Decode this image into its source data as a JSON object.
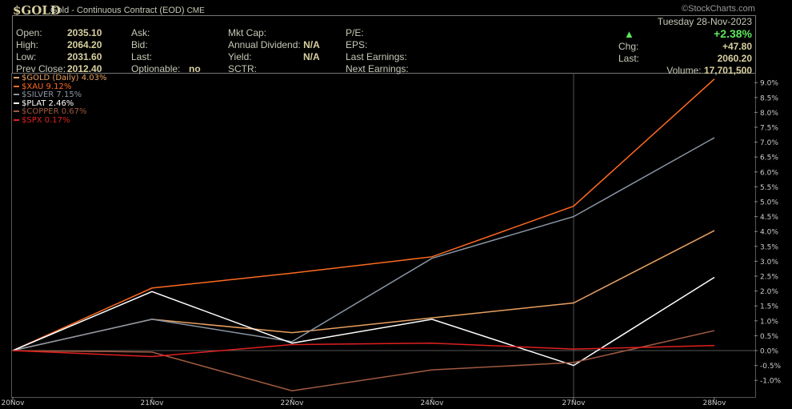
{
  "header": {
    "symbol": "$GOLD",
    "description": "Gold - Continuous Contract (EOD)",
    "exchange": "CME",
    "watermark": "©StockCharts.com"
  },
  "quote": {
    "open_label": "Open:",
    "open": "2035.10",
    "high_label": "High:",
    "high": "2064.20",
    "low_label": "Low:",
    "low": "2031.60",
    "prev_label": "Prev Close:",
    "prev": "2012.40",
    "ask_label": "Ask:",
    "bid_label": "Bid:",
    "last_label": "Last:",
    "optionable_label": "Optionable:",
    "optionable": "no",
    "mktcap_label": "Mkt Cap:",
    "div_label": "Annual Dividend:",
    "div": "N/A",
    "yield_label": "Yield:",
    "yield": "N/A",
    "sctr_label": "SCTR:",
    "pe_label": "P/E:",
    "eps_label": "EPS:",
    "lastearn_label": "Last Earnings:",
    "nextearn_label": "Next Earnings:",
    "date": "Tuesday  28-Nov-2023",
    "pct": "+2.38%",
    "chg_label": "Chg:",
    "chg": "+47.80",
    "last2_label": "Last:",
    "last2": "2060.20",
    "vol_label": "Volume:",
    "vol": "17,701,500"
  },
  "chart_data": {
    "type": "line",
    "categories": [
      "20Nov",
      "21Nov",
      "22Nov",
      "24Nov",
      "27Nov",
      "28Nov"
    ],
    "ylim": [
      -1.35,
      9.2
    ],
    "yticks": [
      "9.0%",
      "8.5%",
      "8.0%",
      "7.5%",
      "7.0%",
      "6.5%",
      "6.0%",
      "5.5%",
      "5.0%",
      "4.5%",
      "4.0%",
      "3.5%",
      "3.0%",
      "2.5%",
      "2.0%",
      "1.5%",
      "1.0%",
      "0.5%",
      "0.0%",
      "-0.5%",
      "-1.0%"
    ],
    "series": [
      {
        "name": "$GOLD (Daily) 4.03%",
        "color": "#e8a060",
        "values": [
          0,
          1.05,
          0.6,
          1.1,
          1.6,
          4.03
        ]
      },
      {
        "name": "$XAU 9.12%",
        "color": "#ff6a20",
        "values": [
          0,
          2.1,
          2.6,
          3.15,
          4.85,
          9.12
        ]
      },
      {
        "name": "$SILVER 7.15%",
        "color": "#8a96a4",
        "values": [
          0,
          1.05,
          0.3,
          3.1,
          4.5,
          7.15
        ]
      },
      {
        "name": "$PLAT 2.46%",
        "color": "#ffffff",
        "values": [
          0,
          1.98,
          0.25,
          1.05,
          -0.5,
          2.46
        ]
      },
      {
        "name": "$COPPER 0.67%",
        "color": "#a05a40",
        "values": [
          0,
          -0.05,
          -1.35,
          -0.65,
          -0.4,
          0.67
        ]
      },
      {
        "name": "$SPX 0.17%",
        "color": "#e02020",
        "values": [
          0,
          -0.2,
          0.2,
          0.25,
          0.05,
          0.17
        ]
      }
    ]
  }
}
